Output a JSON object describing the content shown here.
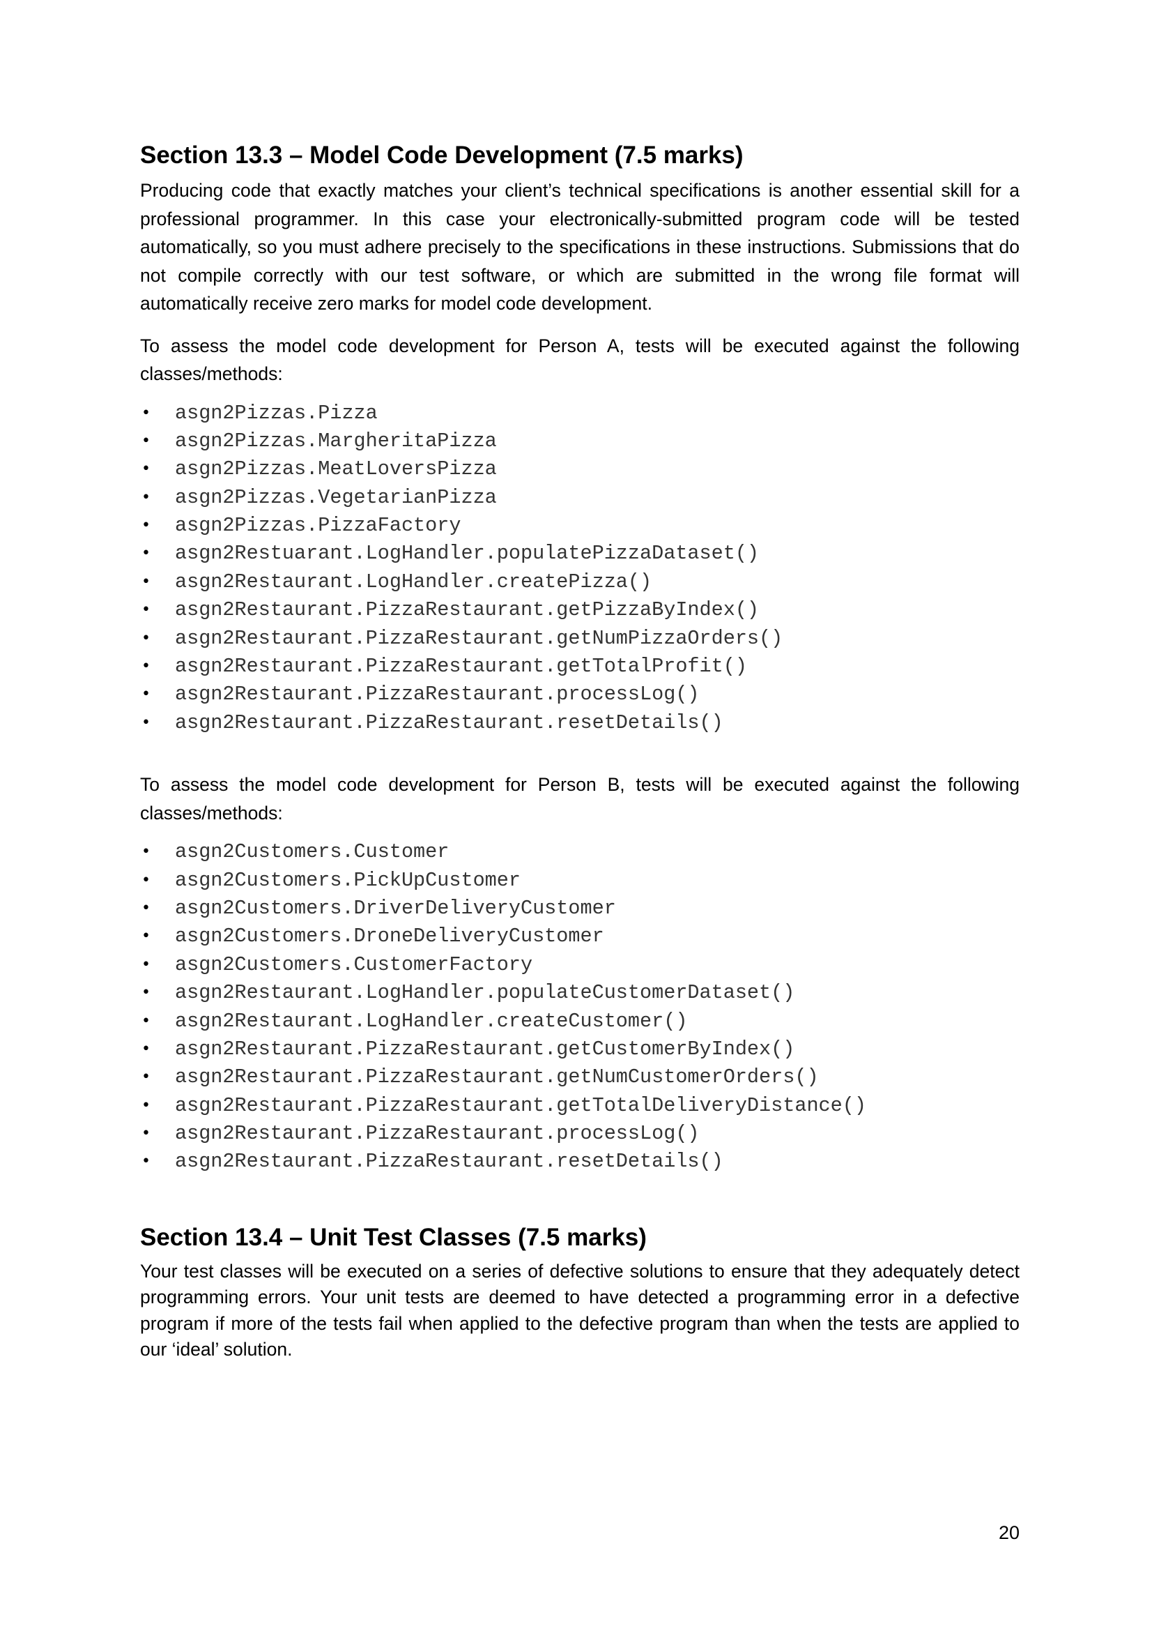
{
  "section_13_3": {
    "heading": "Section 13.3 – Model Code Development (7.5 marks)",
    "intro": "Producing code that exactly matches your client’s technical specifications is another essential skill for a professional programmer.  In this case your electronically-submitted program code will be tested automatically, so you must adhere precisely to the specifications in these instructions.  Submissions that do not compile correctly with our test software, or which are submitted in the wrong file format will automatically receive zero marks for model code development.",
    "person_a_intro": "To assess the model code development for Person A, tests will be executed against the following classes/methods:",
    "person_a_items": [
      "asgn2Pizzas.Pizza",
      "asgn2Pizzas.MargheritaPizza",
      "asgn2Pizzas.MeatLoversPizza",
      "asgn2Pizzas.VegetarianPizza",
      "asgn2Pizzas.PizzaFactory",
      "asgn2Restuarant.LogHandler.populatePizzaDataset()",
      "asgn2Restaurant.LogHandler.createPizza()",
      "asgn2Restaurant.PizzaRestaurant.getPizzaByIndex()",
      "asgn2Restaurant.PizzaRestaurant.getNumPizzaOrders()",
      "asgn2Restaurant.PizzaRestaurant.getTotalProfit()",
      "asgn2Restaurant.PizzaRestaurant.processLog()",
      "asgn2Restaurant.PizzaRestaurant.resetDetails()"
    ],
    "person_b_intro": "To assess the model code development for Person B, tests will be executed against the following classes/methods:",
    "person_b_items": [
      "asgn2Customers.Customer",
      "asgn2Customers.PickUpCustomer",
      "asgn2Customers.DriverDeliveryCustomer",
      "asgn2Customers.DroneDeliveryCustomer",
      "asgn2Customers.CustomerFactory",
      "asgn2Restaurant.LogHandler.populateCustomerDataset()",
      "asgn2Restaurant.LogHandler.createCustomer()",
      "asgn2Restaurant.PizzaRestaurant.getCustomerByIndex()",
      "asgn2Restaurant.PizzaRestaurant.getNumCustomerOrders()",
      "asgn2Restaurant.PizzaRestaurant.getTotalDeliveryDistance()",
      "asgn2Restaurant.PizzaRestaurant.processLog()",
      "asgn2Restaurant.PizzaRestaurant.resetDetails()"
    ]
  },
  "section_13_4": {
    "heading": "Section 13.4 – Unit Test Classes (7.5 marks)",
    "body": "Your test classes will be executed on a series of defective solutions to ensure that they adequately detect programming errors. Your unit tests are deemed to have detected a programming error in a defective program if more of the tests fail when applied to the defective program than when the tests are applied to our ‘ideal’ solution."
  },
  "bullet_glyph": "•",
  "page_number": "20"
}
